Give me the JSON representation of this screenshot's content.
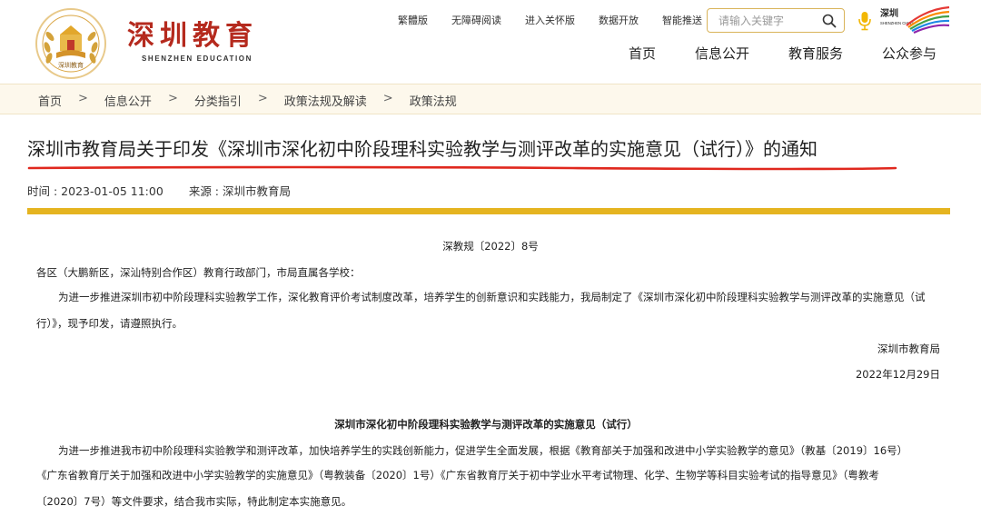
{
  "header": {
    "logo_emblem_text": "深圳教育",
    "logo_cn": "深圳教育",
    "logo_en": "SHENZHEN EDUCATION",
    "top_links": [
      "繁體版",
      "无障碍阅读",
      "进入关怀版",
      "数据开放",
      "智能推送"
    ],
    "search": {
      "placeholder": "请输入关键字"
    },
    "brand_logo_text": "深圳 SHENZHEN CHINA",
    "main_nav": [
      "首页",
      "信息公开",
      "教育服务",
      "公众参与"
    ]
  },
  "breadcrumb": [
    "首页",
    "信息公开",
    "分类指引",
    "政策法规及解读",
    "政策法规"
  ],
  "breadcrumb_separator": ">",
  "article": {
    "title": "深圳市教育局关于印发《深圳市深化初中阶段理科实验教学与测评改革的实施意见（试行）》的通知",
    "time_label": "时间 : 2023-01-05 11:00",
    "source_label": "来源 : 深圳市教育局",
    "doc_no": "深教规〔2022〕8号",
    "addressee": "各区（大鹏新区，深汕特别合作区）教育行政部门，市局直属各学校：",
    "body1_line1": "为进一步推进深圳市初中阶段理科实验教学工作，深化教育评价考试制度改革，培养学生的创新意识和实践能力，我局制定了《深圳市深化初中阶段理科实验教学与测评改革的实施意见（试",
    "body1_line2": "行）》，现予印发，请遵照执行。",
    "signature": "深圳市教育局",
    "sign_date": "2022年12月29日",
    "subtitle": "深圳市深化初中阶段理科实验教学与测评改革的实施意见（试行）",
    "body2_line1": "为进一步推进我市初中阶段理科实验教学和测评改革，加快培养学生的实践创新能力，促进学生全面发展，根据《教育部关于加强和改进中小学实验教学的意见》（教基〔2019〕16号）",
    "body2_line2": "《广东省教育厅关于加强和改进中小学实验教学的实施意见》（粤教装备〔2020〕1号）《广东省教育厅关于初中学业水平考试物理、化学、生物学等科目实验考试的指导意见》（粤教考",
    "body2_line3": "〔2020〕7号）等文件要求，结合我市实际，特此制定本实施意见。"
  },
  "colors": {
    "brand_red": "#b52a1e",
    "gold": "#e5b420",
    "underline_red": "#e0281e",
    "crumb_bg": "#fdf8ec"
  }
}
